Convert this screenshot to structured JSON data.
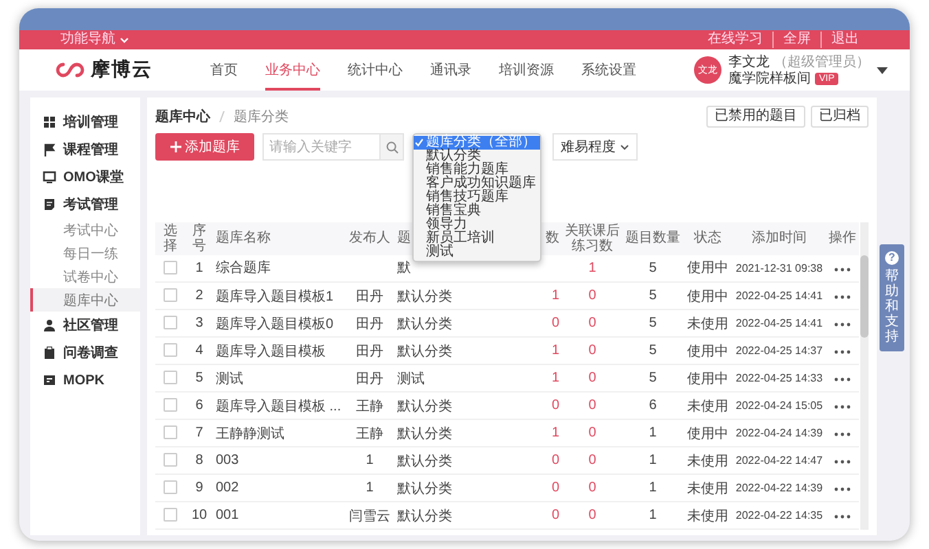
{
  "top_bar": {
    "menu_label": "功能导航",
    "links": [
      "在线学习",
      "全屏",
      "退出"
    ]
  },
  "header": {
    "logo_text": "摩博云",
    "nav": [
      {
        "label": "首页",
        "selected": false
      },
      {
        "label": "业务中心",
        "selected": true
      },
      {
        "label": "统计中心",
        "selected": false
      },
      {
        "label": "通讯录",
        "selected": false
      },
      {
        "label": "培训资源",
        "selected": false
      },
      {
        "label": "系统设置",
        "selected": false
      }
    ],
    "user": {
      "avatar_text": "文龙",
      "name": "李文龙",
      "role": "（超级管理员）",
      "org": "魔学院样板间",
      "badge": "VIP"
    }
  },
  "sidebar": {
    "items": [
      {
        "label": "培训管理"
      },
      {
        "label": "课程管理"
      },
      {
        "label": "OMO课堂"
      },
      {
        "label": "考试管理",
        "children": [
          {
            "label": "考试中心",
            "selected": false
          },
          {
            "label": "每日一练",
            "selected": false
          },
          {
            "label": "试卷中心",
            "selected": false
          },
          {
            "label": "题库中心",
            "selected": true
          }
        ]
      },
      {
        "label": "社区管理"
      },
      {
        "label": "问卷调查"
      },
      {
        "label": "MOPK"
      }
    ]
  },
  "toolbar": {
    "breadcrumb": [
      "题库中心",
      "题库分类"
    ],
    "actions": [
      "已禁用的题目",
      "已归档"
    ],
    "add_button": "添加题库",
    "search": {
      "placeholder": "请输入关键字"
    },
    "difficulty_select": "难易程度"
  },
  "category_dropdown": {
    "items": [
      {
        "label": "题库分类（全部）",
        "selected": true
      },
      {
        "label": "默认分类",
        "selected": false
      },
      {
        "label": "销售能力题库",
        "selected": false
      },
      {
        "label": "客户成功知识题库",
        "selected": false
      },
      {
        "label": "销售技巧题库",
        "selected": false
      },
      {
        "label": "销售宝典",
        "selected": false
      },
      {
        "label": "领导力",
        "selected": false
      },
      {
        "label": "新员工培训",
        "selected": false
      },
      {
        "label": "测试",
        "selected": false
      }
    ]
  },
  "table": {
    "columns": [
      "选择",
      "序号",
      "题库名称",
      "发布人",
      "题",
      "数",
      "关联课后练习数",
      "题目数量",
      "状态",
      "添加时间",
      "操作"
    ],
    "rows": [
      {
        "checked": false,
        "index": "1",
        "name": "综合题库",
        "category": "默",
        "practice_count": "1",
        "question_count": "5",
        "status": "使用中",
        "added": "2021-12-31 09:38"
      },
      {
        "checked": false,
        "index": "2",
        "name": "题库导入题目模板1",
        "publisher": "田丹",
        "category": "默认分类",
        "column_6": "1",
        "practice_count": "0",
        "question_count": "5",
        "status": "使用中",
        "added": "2022-04-25 14:41"
      },
      {
        "checked": false,
        "index": "3",
        "name": "题库导入题目模板0",
        "publisher": "田丹",
        "category": "默认分类",
        "column_6": "0",
        "practice_count": "0",
        "question_count": "5",
        "status": "未使用",
        "added": "2022-04-25 14:41"
      },
      {
        "checked": false,
        "index": "4",
        "name": "题库导入题目模板",
        "publisher": "田丹",
        "category": "默认分类",
        "column_6": "1",
        "practice_count": "0",
        "question_count": "5",
        "status": "使用中",
        "added": "2022-04-25 14:37"
      },
      {
        "checked": false,
        "index": "5",
        "name": "测试",
        "publisher": "田丹",
        "category": "测试",
        "column_6": "1",
        "practice_count": "0",
        "question_count": "5",
        "status": "使用中",
        "added": "2022-04-25 14:33"
      },
      {
        "checked": false,
        "index": "6",
        "name": "题库导入题目模板 ...",
        "publisher": "王静",
        "category": "默认分类",
        "column_6": "0",
        "practice_count": "0",
        "question_count": "6",
        "status": "未使用",
        "added": "2022-04-24 15:05"
      },
      {
        "checked": false,
        "index": "7",
        "name": "王静静测试",
        "publisher": "王静",
        "category": "默认分类",
        "column_6": "1",
        "practice_count": "0",
        "question_count": "1",
        "status": "使用中",
        "added": "2022-04-24 14:39"
      },
      {
        "checked": false,
        "index": "8",
        "name": "003",
        "publisher": "1",
        "category": "默认分类",
        "column_6": "0",
        "practice_count": "0",
        "question_count": "1",
        "status": "未使用",
        "added": "2022-04-22 14:47"
      },
      {
        "checked": false,
        "index": "9",
        "name": "002",
        "publisher": "1",
        "category": "默认分类",
        "column_6": "0",
        "practice_count": "0",
        "question_count": "1",
        "status": "未使用",
        "added": "2022-04-22 14:39"
      },
      {
        "checked": false,
        "index": "10",
        "name": "001",
        "publisher": "闫雪云",
        "category": "默认分类",
        "column_6": "0",
        "practice_count": "0",
        "question_count": "1",
        "status": "未使用",
        "added": "2022-04-22 14:35"
      }
    ]
  },
  "help": {
    "icon": "?",
    "label": "帮助和支持"
  }
}
